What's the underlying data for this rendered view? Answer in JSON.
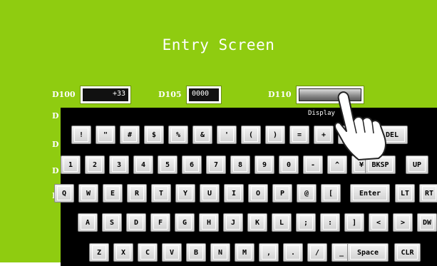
{
  "screen": {
    "title": "Entry Screen",
    "background_color": "#8fcc10",
    "fields": [
      {
        "label": "D100",
        "value": "+33"
      },
      {
        "label": "D105",
        "value": "0000"
      },
      {
        "label": "D110",
        "value": ""
      }
    ],
    "side_labels": [
      "D",
      "D",
      "D",
      "D"
    ]
  },
  "keyboard": {
    "display_label": "Display",
    "rows": [
      [
        "!",
        "\"",
        "#",
        "$",
        "%",
        "&",
        "'",
        "(",
        ")",
        "=",
        "+",
        "",
        "",
        "DEL"
      ],
      [
        "1",
        "2",
        "3",
        "4",
        "5",
        "6",
        "7",
        "8",
        "9",
        "0",
        "-",
        "^",
        "¥",
        "BKSP",
        "UP"
      ],
      [
        "Q",
        "W",
        "E",
        "R",
        "T",
        "Y",
        "U",
        "I",
        "O",
        "P",
        "@",
        "[",
        "Enter",
        "LT",
        "RT"
      ],
      [
        "A",
        "S",
        "D",
        "F",
        "G",
        "H",
        "J",
        "K",
        "L",
        ";",
        ":",
        "]",
        "<",
        ">",
        "DW"
      ],
      [
        "Z",
        "X",
        "C",
        "V",
        "B",
        "N",
        "M",
        ",",
        ".",
        "/",
        "_",
        "Space",
        "CLR"
      ]
    ]
  },
  "pointer": {
    "icon": "hand-pointer-icon"
  }
}
